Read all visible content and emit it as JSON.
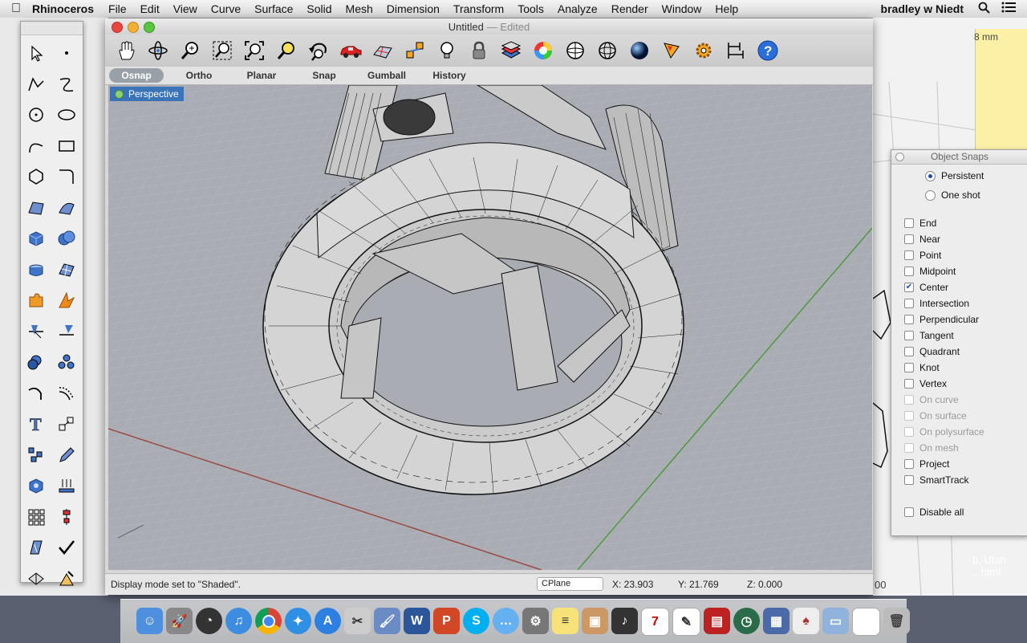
{
  "menubar": {
    "app_name": "Rhinoceros",
    "items": [
      "File",
      "Edit",
      "View",
      "Curve",
      "Surface",
      "Solid",
      "Mesh",
      "Dimension",
      "Transform",
      "Tools",
      "Analyze",
      "Render",
      "Window",
      "Help"
    ],
    "user": "bradley w Niedt"
  },
  "window": {
    "title": "Untitled",
    "edited": "— Edited"
  },
  "toolbar": {
    "icons": [
      "hand-pan-icon",
      "rotate-view-icon",
      "zoom-icon",
      "zoom-window-icon",
      "zoom-extents-icon",
      "zoom-selected-icon",
      "undo-view-icon",
      "car-icon",
      "grid-plane-icon",
      "snap-objects-icon",
      "light-bulb-icon",
      "lock-icon",
      "layers-icon",
      "color-wheel-icon",
      "sphere-wire-icon",
      "sphere-mesh-icon",
      "render-sphere-icon",
      "pencil-icon",
      "gear-icon",
      "dimension-icon",
      "help-icon"
    ]
  },
  "modes": [
    "Osnap",
    "Ortho",
    "Planar",
    "Snap",
    "Gumball",
    "History"
  ],
  "viewport": {
    "label": "Perspective"
  },
  "status": {
    "message": "Display mode set to \"Shaded\".",
    "cplane": "CPlane",
    "x": "X: 23.903",
    "y": "Y: 21.769",
    "z": "Z: 0.000"
  },
  "osnap": {
    "title": "Object Snaps",
    "modes": [
      {
        "label": "Persistent",
        "selected": true
      },
      {
        "label": "One shot",
        "selected": false
      }
    ],
    "snaps": [
      {
        "label": "End",
        "checked": false,
        "disabled": false
      },
      {
        "label": "Near",
        "checked": false,
        "disabled": false
      },
      {
        "label": "Point",
        "checked": false,
        "disabled": false
      },
      {
        "label": "Midpoint",
        "checked": false,
        "disabled": false
      },
      {
        "label": "Center",
        "checked": true,
        "disabled": false
      },
      {
        "label": "Intersection",
        "checked": false,
        "disabled": false
      },
      {
        "label": "Perpendicular",
        "checked": false,
        "disabled": false
      },
      {
        "label": "Tangent",
        "checked": false,
        "disabled": false
      },
      {
        "label": "Quadrant",
        "checked": false,
        "disabled": false
      },
      {
        "label": "Knot",
        "checked": false,
        "disabled": false
      },
      {
        "label": "Vertex",
        "checked": false,
        "disabled": false
      },
      {
        "label": "On curve",
        "checked": false,
        "disabled": true
      },
      {
        "label": "On surface",
        "checked": false,
        "disabled": true
      },
      {
        "label": "On polysurface",
        "checked": false,
        "disabled": true
      },
      {
        "label": "On mesh",
        "checked": false,
        "disabled": true
      },
      {
        "label": "Project",
        "checked": false,
        "disabled": false
      },
      {
        "label": "SmartTrack",
        "checked": false,
        "disabled": false
      }
    ],
    "disable_all": "Disable all"
  },
  "background": {
    "right_text_1": "8 mm",
    "right_text_2": "b, Utah",
    "right_text_3": "...html",
    "right_text_4": "00"
  },
  "dock": {
    "calendar_day": "7",
    "icons": [
      "finder-icon",
      "launchpad-icon",
      "dashboard-icon",
      "itunes-icon",
      "chrome-icon",
      "safari-icon",
      "app-store-icon",
      "scissors-icon",
      "paint-icon",
      "word-icon",
      "powerpoint-icon",
      "skype-icon",
      "messages-icon",
      "system-prefs-icon",
      "stickies-icon",
      "photos-icon",
      "audio-icon",
      "calendar-icon",
      "text-edit-icon",
      "photo-booth-icon",
      "time-machine-icon",
      "preview-icon",
      "cards-icon",
      "documents-folder-icon",
      "file-icon",
      "trash-icon"
    ]
  }
}
